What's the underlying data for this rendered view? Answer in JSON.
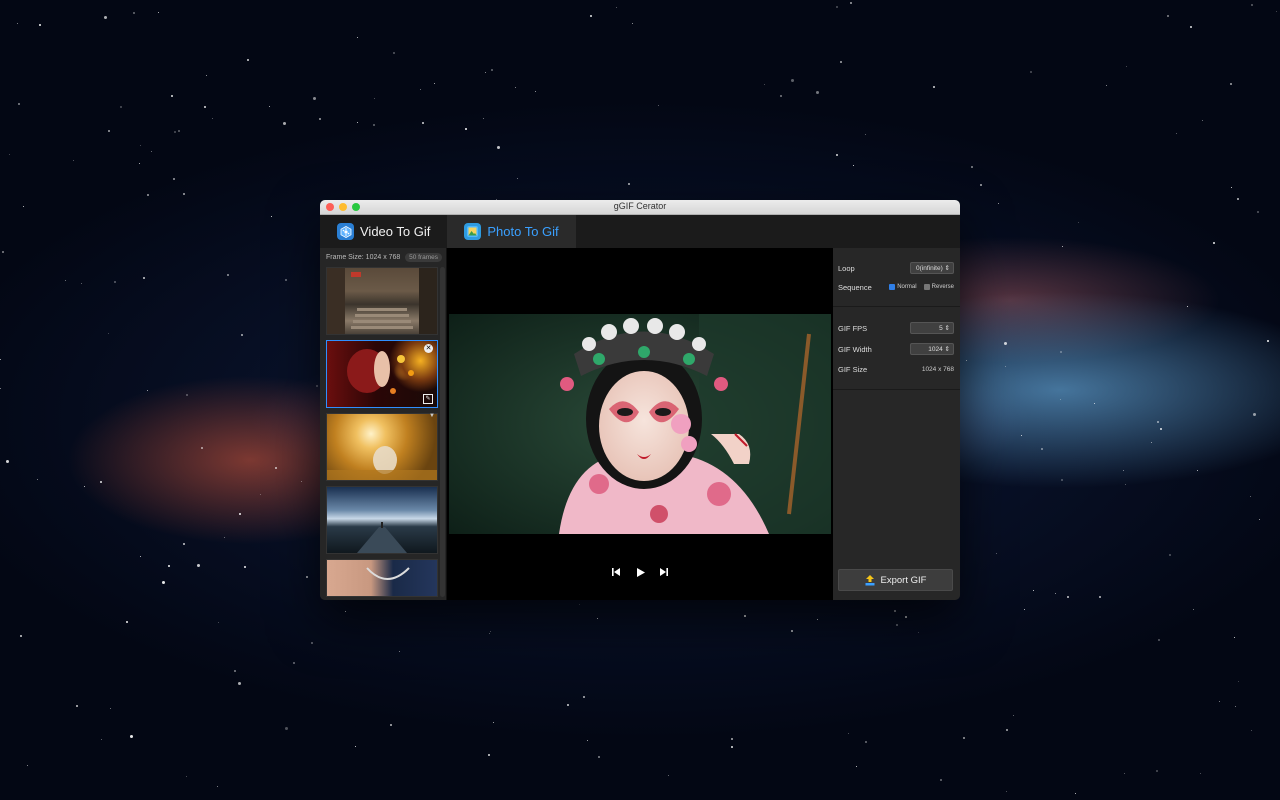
{
  "window": {
    "title": "gGIF Cerator"
  },
  "tabs": [
    {
      "label": "Video To Gif",
      "icon": "film-hex-icon",
      "active": false
    },
    {
      "label": "Photo To Gif",
      "icon": "photo-icon",
      "active": true
    }
  ],
  "frames": {
    "frame_size_label": "Frame Size: 1024 x 768",
    "frame_count": "50 frames",
    "thumbnails": [
      {
        "name": "frame-1-alley"
      },
      {
        "name": "frame-2-woman-bokeh",
        "selected": true
      },
      {
        "name": "frame-3-sunlight-field"
      },
      {
        "name": "frame-4-road-horizon"
      },
      {
        "name": "frame-5-necklace"
      }
    ]
  },
  "player": {
    "prev_icon": "skip-back-icon",
    "play_icon": "play-icon",
    "next_icon": "skip-forward-icon"
  },
  "settings": {
    "loop_label": "Loop",
    "loop_value": "0(infinite)",
    "sequence_label": "Sequence",
    "sequence_normal": "Normal",
    "sequence_normal_checked": true,
    "sequence_reverse": "Reverse",
    "sequence_reverse_checked": false,
    "fps_label": "GIF FPS",
    "fps_value": "5",
    "width_label": "GIF Width",
    "width_value": "1024",
    "size_label": "GIF Size",
    "size_value": "1024 x 768",
    "export_label": "Export GIF"
  },
  "colors": {
    "accent": "#3aa0ff",
    "close": "#fd5f57",
    "minimize": "#febc2e",
    "zoom": "#28c840"
  }
}
